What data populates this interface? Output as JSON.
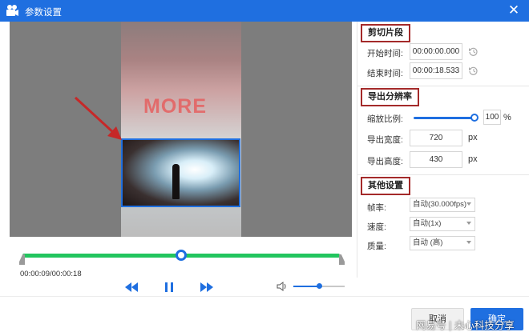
{
  "window": {
    "title": "参数设置",
    "icon": "camera-icon",
    "close_icon": "close-icon"
  },
  "preview": {
    "stage_text": "MORE",
    "annotation": "red-arrow-icon"
  },
  "playback": {
    "timecode": "00:00:09/00:00:18",
    "progress_fraction": 0.5,
    "volume_fraction": 0.5,
    "buttons": [
      "rewind-icon",
      "pause-icon",
      "fast-forward-icon"
    ],
    "volume_icon": "speaker-icon"
  },
  "clip": {
    "title": "剪切片段",
    "start_label": "开始时间:",
    "start_value": "00:00:00.000",
    "end_label": "结束时间:",
    "end_value": "00:00:18.533"
  },
  "resolution": {
    "title": "导出分辨率",
    "scale_label": "缩放比例:",
    "scale_value": "100",
    "scale_unit": "%",
    "scale_fraction": 1.0,
    "width_label": "导出宽度:",
    "width_value": "720",
    "width_unit": "px",
    "height_label": "导出高度:",
    "height_value": "430",
    "height_unit": "px"
  },
  "other": {
    "title": "其他设置",
    "fps_label": "帧率:",
    "fps_value": "自动(30.000fps)",
    "speed_label": "速度:",
    "speed_value": "自动(1x)",
    "quality_label": "质量:",
    "quality_value": "自动 (高)"
  },
  "footer": {
    "cancel_label": "取消",
    "ok_label": "确定",
    "watermark": "网易号 | 未心科技分享"
  },
  "colors": {
    "accent": "#1f6fe0",
    "timeline": "#22c55e",
    "highlight_box": "#a42a2a"
  }
}
